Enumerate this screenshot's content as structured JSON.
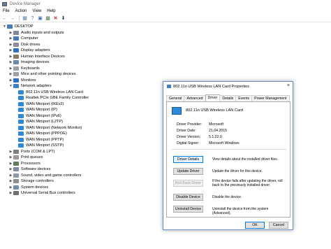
{
  "window": {
    "title": "Device Manager"
  },
  "menu": [
    "File",
    "Action",
    "View",
    "Help"
  ],
  "toolbar": {
    "buttons": [
      "back-icon",
      "forward-icon",
      "properties-icon",
      "help-icon",
      "update-driver-icon",
      "scan-icon",
      "uninstall-icon",
      "download-icon"
    ]
  },
  "tree": {
    "root": "DESKTOP",
    "items": [
      {
        "label": "Audio inputs and outputs",
        "icon": "audio-icon"
      },
      {
        "label": "Computer",
        "icon": "computer-icon"
      },
      {
        "label": "Disk drives",
        "icon": "disk-icon"
      },
      {
        "label": "Display adapters",
        "icon": "display-icon"
      },
      {
        "label": "Human Interface Devices",
        "icon": "hid-icon"
      },
      {
        "label": "Imaging devices",
        "icon": "camera-icon"
      },
      {
        "label": "Keyboards",
        "icon": "keyboard-icon"
      },
      {
        "label": "Mice and other pointing devices",
        "icon": "mouse-icon"
      },
      {
        "label": "Monitors",
        "icon": "monitor-icon"
      },
      {
        "label": "Network adapters",
        "icon": "network-icon"
      }
    ],
    "network_children": [
      "802.11n USB Wireless LAN Card",
      "Realtek PCIe GBE Family Controller",
      "WAN Miniport (IKEv2)",
      "WAN Miniport (IP)",
      "WAN Miniport (IPv6)",
      "WAN Miniport (L2TP)",
      "WAN Miniport (Network Monitor)",
      "WAN Miniport (PPPOE)",
      "WAN Miniport (PPTP)",
      "WAN Miniport (SSTP)"
    ],
    "after": [
      {
        "label": "Ports (COM & LPT)",
        "icon": "port-icon"
      },
      {
        "label": "Print queues",
        "icon": "printer-icon"
      },
      {
        "label": "Processors",
        "icon": "processor-icon"
      },
      {
        "label": "Software devices",
        "icon": "software-icon"
      },
      {
        "label": "Sound, video and game controllers",
        "icon": "speaker-icon"
      },
      {
        "label": "Storage controllers",
        "icon": "storage-icon"
      },
      {
        "label": "System devices",
        "icon": "system-icon"
      },
      {
        "label": "Universal Serial Bus controllers",
        "icon": "usb-icon"
      }
    ]
  },
  "dialog": {
    "title": "802.11n USB Wireless LAN Card Properties",
    "close": "×",
    "tabs": [
      "General",
      "Advanced",
      "Driver",
      "Details",
      "Events",
      "Power Management"
    ],
    "active_tab": "Driver",
    "device_name": "802.11n USB Wireless LAN Card",
    "info": [
      {
        "key": "Driver Provider:",
        "value": "Microsoft"
      },
      {
        "key": "Driver Date:",
        "value": "21.04.2015"
      },
      {
        "key": "Driver Version:",
        "value": "5.1.22.0"
      },
      {
        "key": "Digital Signer:",
        "value": "Microsoft Windows"
      }
    ],
    "actions": [
      {
        "button": "Driver Details",
        "desc": "View details about the installed driver files.",
        "state": "focus"
      },
      {
        "button": "Update Driver",
        "desc": "Update the driver for this device.",
        "state": "normal"
      },
      {
        "button": "Roll Back Driver",
        "desc": "If the device fails after updating the driver, roll back to the previously installed driver.",
        "state": "disabled"
      },
      {
        "button": "Disable Device",
        "desc": "Disable the device.",
        "state": "normal"
      },
      {
        "button": "Uninstall Device",
        "desc": "Uninstall the device from the system (Advanced).",
        "state": "normal"
      }
    ],
    "ok": "OK",
    "cancel": "Cancel"
  }
}
